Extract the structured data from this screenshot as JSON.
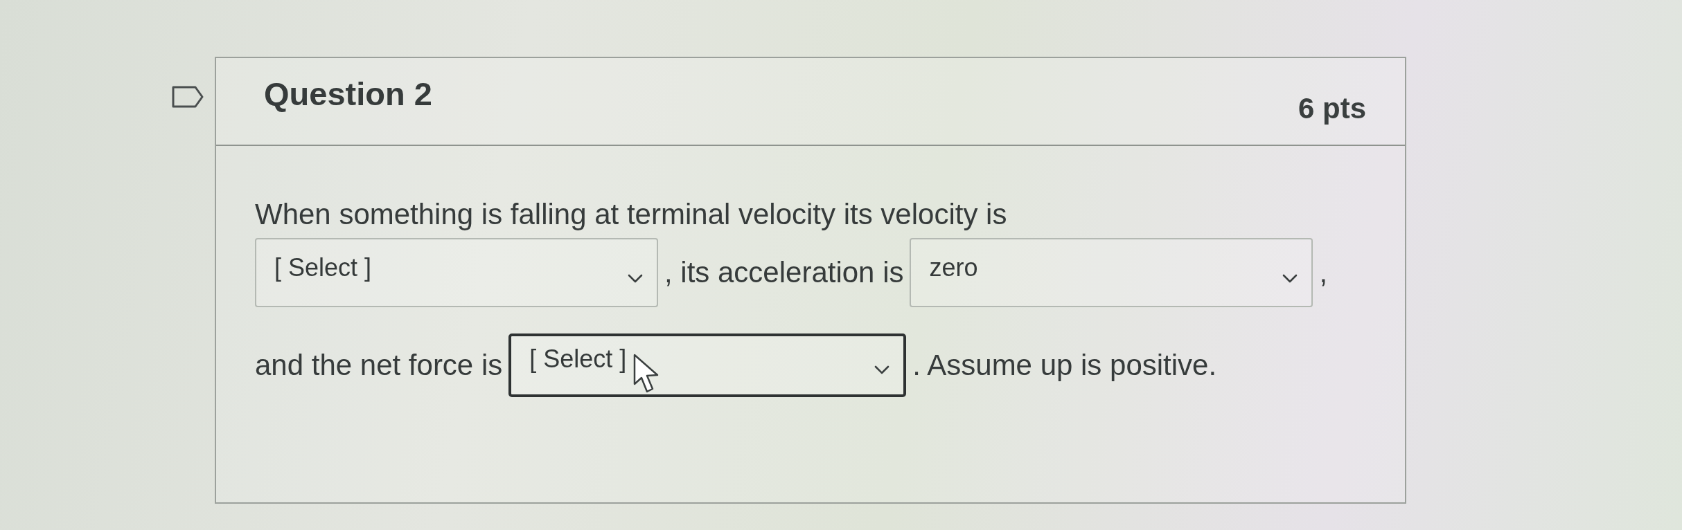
{
  "question": {
    "flagged": false,
    "title": "Question 2",
    "points": "6 pts"
  },
  "lines": [
    [
      {
        "kind": "text",
        "text": "When something is falling at terminal velocity its velocity is"
      }
    ],
    [
      {
        "kind": "select",
        "placeholder": "[ Select ]",
        "focused": false
      },
      {
        "kind": "text",
        "text": ", its acceleration is"
      },
      {
        "kind": "select",
        "value": "zero",
        "focused": false
      },
      {
        "kind": "text",
        "text": ","
      }
    ],
    [
      {
        "kind": "text",
        "text": "and the net force is"
      },
      {
        "kind": "select",
        "placeholder": "[ Select ]",
        "focused": true
      },
      {
        "kind": "text",
        "text": ". Assume up is positive."
      }
    ]
  ]
}
